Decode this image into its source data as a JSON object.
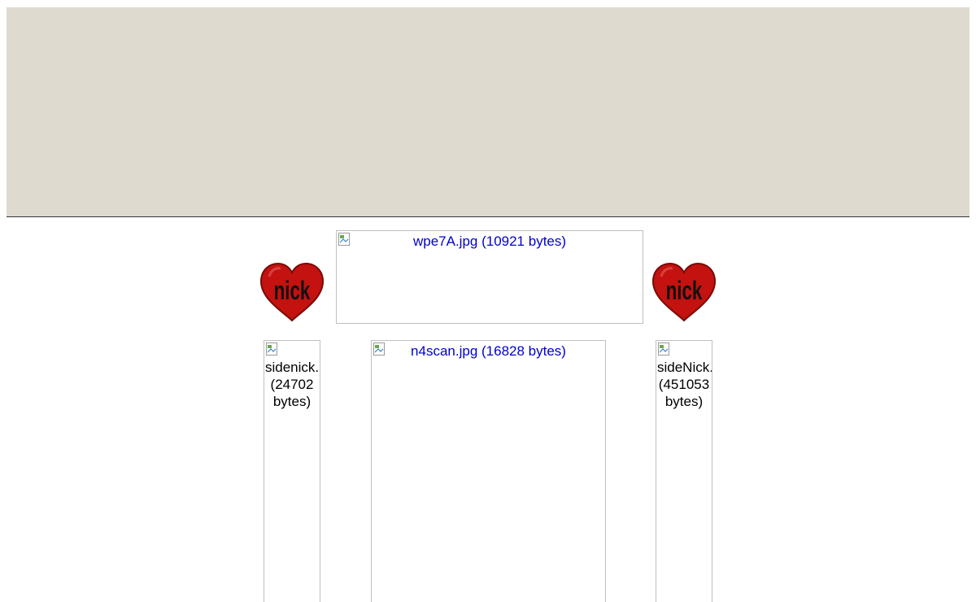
{
  "banner": {
    "color": "#dfdad0"
  },
  "hearts": [
    {
      "label": "nick"
    },
    {
      "label": "nick"
    }
  ],
  "images": {
    "top": {
      "caption": "wpe7A.jpg (10921 bytes)"
    },
    "center": {
      "caption": "n4scan.jpg (16828 bytes)"
    },
    "left": {
      "line1": "sidenick.",
      "line2": "(24702",
      "line3": "bytes)"
    },
    "right": {
      "line1": "sideNick.",
      "line2": "(451053",
      "line3": "bytes)"
    }
  }
}
